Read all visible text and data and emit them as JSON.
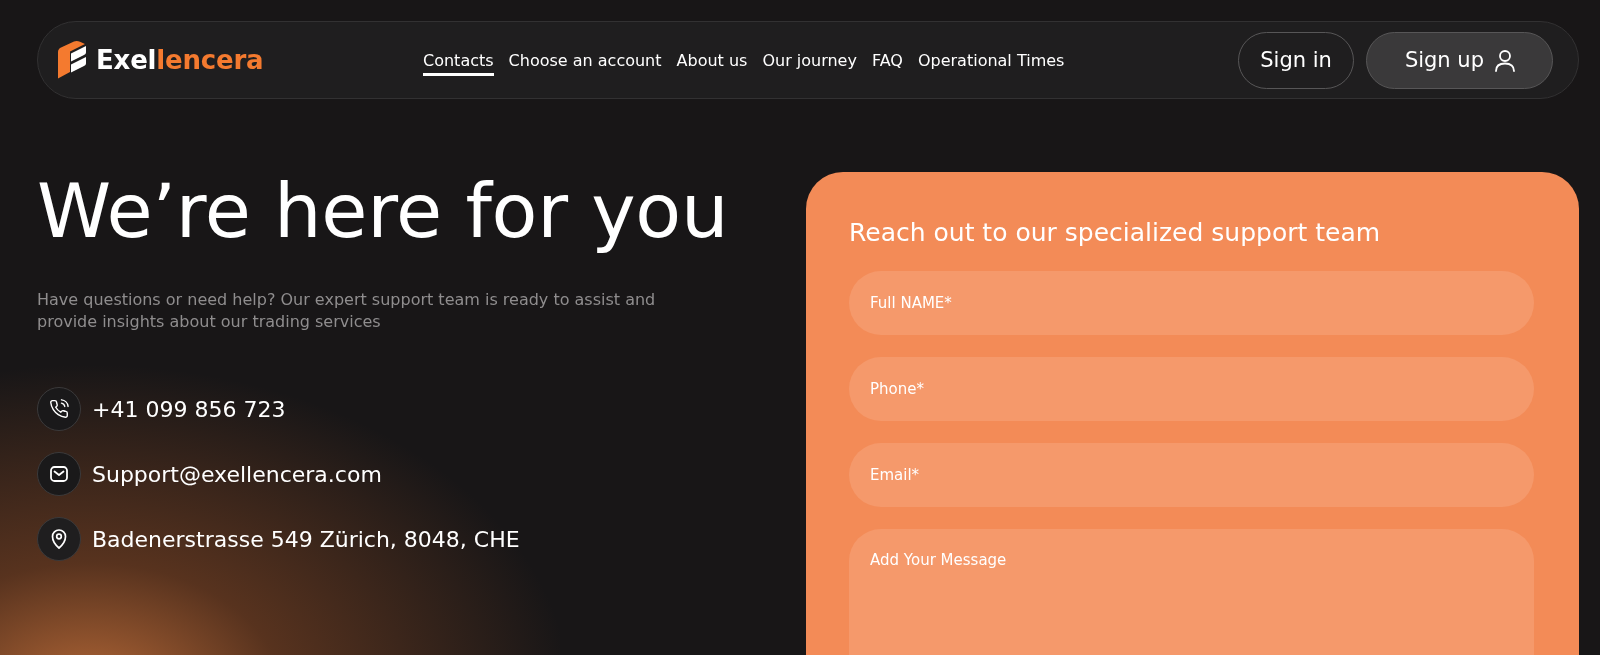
{
  "header": {
    "logo": {
      "lead": "Exel",
      "accent": "lencera"
    },
    "nav": [
      {
        "label": "Contacts",
        "selected": true
      },
      {
        "label": "Choose an account",
        "selected": false
      },
      {
        "label": "About us",
        "selected": false
      },
      {
        "label": "Our journey",
        "selected": false
      },
      {
        "label": "FAQ",
        "selected": false
      },
      {
        "label": "Operational Times",
        "selected": false
      }
    ],
    "sign_in": {
      "label": "Sign in"
    },
    "sign_up": {
      "label": "Sign up"
    }
  },
  "hero": {
    "title": "We’re here for you",
    "subtitle": "Have questions or need help? Our expert support team is ready to assist and provide insights about our trading services",
    "contacts": [
      {
        "kind": "phone",
        "text": "+41 099 856 723"
      },
      {
        "kind": "email",
        "text": "Support@exellencera.com"
      },
      {
        "kind": "address",
        "text": "Badenerstrasse 549 Zürich, 8048, CHE"
      }
    ]
  },
  "form": {
    "title": "Reach out to our specialized support team",
    "fields": [
      {
        "kind": "input",
        "placeholder": "Full NAME*"
      },
      {
        "kind": "input",
        "placeholder": "Phone*"
      },
      {
        "kind": "input",
        "placeholder": "Email*"
      },
      {
        "kind": "textarea",
        "placeholder": "Add Your Message"
      }
    ]
  }
}
